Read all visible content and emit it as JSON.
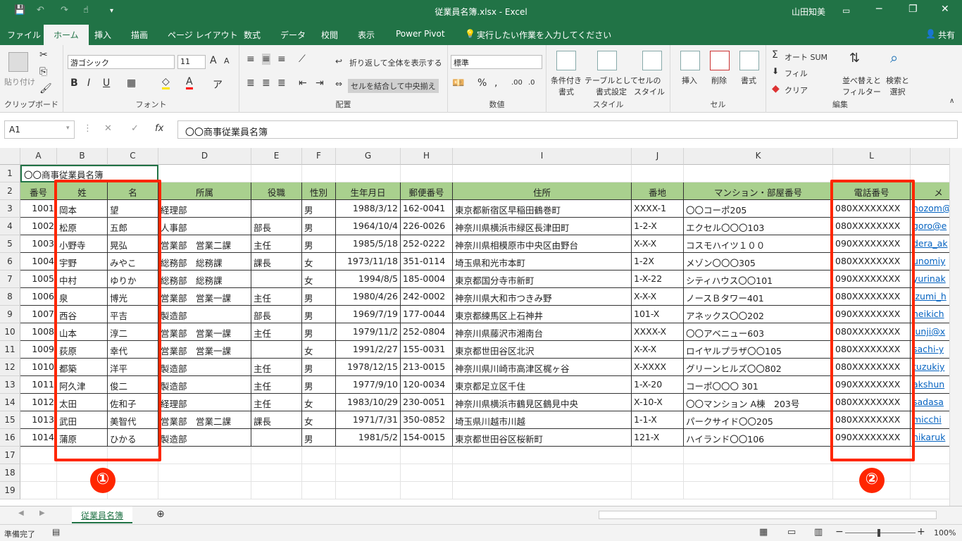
{
  "titlebar": {
    "doc": "従業員名簿.xlsx  -  Excel",
    "user": "山田知美",
    "save": "💾",
    "undo": "↶",
    "redo": "↷",
    "touch": "☝",
    "more": "▾",
    "ribbon_opt": "▭",
    "minimize": "─",
    "restore": "❐",
    "close": "✕"
  },
  "tabs": [
    "ファイル",
    "ホーム",
    "挿入",
    "描画",
    "ページ レイアウト",
    "数式",
    "データ",
    "校閲",
    "表示",
    "Power Pivot"
  ],
  "tellme": "実行したい作業を入力してください",
  "share": "共有",
  "ribbon": {
    "clipboard": {
      "label": "クリップボード",
      "paste": "貼り付け"
    },
    "font": {
      "label": "フォント",
      "name": "游ゴシック",
      "size": "11",
      "bold": "B",
      "italic": "I",
      "underline": "U"
    },
    "align": {
      "label": "配置",
      "wrap": "折り返して全体を表示する",
      "merge": "セルを結合して中央揃え"
    },
    "number": {
      "label": "数値",
      "format": "標準",
      "percent": "%",
      "comma": ","
    },
    "styles": {
      "label": "スタイル",
      "cond": "条件付き\n書式",
      "table": "テーブルとして\n書式設定",
      "cell": "セルの\nスタイル"
    },
    "cells": {
      "label": "セル",
      "insert": "挿入",
      "delete": "削除",
      "format": "書式"
    },
    "edit": {
      "label": "編集",
      "autosum": "オート SUM",
      "fill": "フィル",
      "clear": "クリア",
      "sort": "並べ替えと\nフィルター",
      "find": "検索と\n選択"
    }
  },
  "namebox": "A1",
  "formula": "〇〇商事従業員名簿",
  "fx": "fx",
  "columns": [
    "A",
    "B",
    "C",
    "D",
    "E",
    "F",
    "G",
    "H",
    "I",
    "J",
    "K",
    "L",
    ""
  ],
  "rows": [
    "1",
    "2",
    "3",
    "4",
    "5",
    "6",
    "7",
    "8",
    "9",
    "10",
    "11",
    "12",
    "13",
    "14",
    "15",
    "16",
    "17",
    "18",
    "19"
  ],
  "title": "〇〇商事従業員名簿",
  "headers": [
    "番号",
    "姓",
    "名",
    "所属",
    "役職",
    "性別",
    "生年月日",
    "郵便番号",
    "住所",
    "番地",
    "マンション・部屋番号",
    "電話番号",
    "メ"
  ],
  "data": [
    [
      "1001",
      "岡本",
      "望",
      "経理部",
      "",
      "男",
      "1988/3/12",
      "162-0041",
      "東京都新宿区早稲田鶴巻町",
      "XXXX-1",
      "〇〇コーポ205",
      "080XXXXXXXX",
      "nozom@"
    ],
    [
      "1002",
      "松原",
      "五郎",
      "人事部",
      "部長",
      "男",
      "1964/10/4",
      "226-0026",
      "神奈川県横浜市緑区長津田町",
      "1-2-X",
      "エクセル〇〇〇103",
      "080XXXXXXXX",
      "goro@e"
    ],
    [
      "1003",
      "小野寺",
      "晃弘",
      "営業部　営業二課",
      "主任",
      "男",
      "1985/5/18",
      "252-0222",
      "神奈川県相模原市中央区由野台",
      "X-X-X",
      "コスモハイツ１００",
      "090XXXXXXXX",
      "dera_ak"
    ],
    [
      "1004",
      "宇野",
      "みやこ",
      "総務部　総務課",
      "課長",
      "女",
      "1973/11/18",
      "351-0114",
      "埼玉県和光市本町",
      "1-2X",
      "メゾン〇〇〇305",
      "080XXXXXXXX",
      "unomiy"
    ],
    [
      "1005",
      "中村",
      "ゆりか",
      "総務部　総務課",
      "",
      "女",
      "1994/8/5",
      "185-0004",
      "東京都国分寺市新町",
      "1-X-22",
      "シティハウス〇〇101",
      "090XXXXXXXX",
      "yurinak"
    ],
    [
      "1006",
      "泉",
      "博光",
      "営業部　営業一課",
      "主任",
      "男",
      "1980/4/26",
      "242-0002",
      "神奈川県大和市つきみ野",
      "X-X-X",
      "ノースＢタワー401",
      "080XXXXXXXX",
      "izumi_h"
    ],
    [
      "1007",
      "西谷",
      "平吉",
      "製造部",
      "部長",
      "男",
      "1969/7/19",
      "177-0044",
      "東京都練馬区上石神井",
      "101-X",
      "アネックス〇〇202",
      "090XXXXXXXX",
      "heikich"
    ],
    [
      "1008",
      "山本",
      "淳二",
      "営業部　営業一課",
      "主任",
      "男",
      "1979/11/2",
      "252-0804",
      "神奈川県藤沢市湘南台",
      "XXXX-X",
      "〇〇アベニュー603",
      "080XXXXXXXX",
      "junji@x"
    ],
    [
      "1009",
      "荻原",
      "幸代",
      "営業部　営業一課",
      "",
      "女",
      "1991/2/27",
      "155-0031",
      "東京都世田谷区北沢",
      "X-X-X",
      "ロイヤルプラザ〇〇105",
      "080XXXXXXXX",
      "sachi-y"
    ],
    [
      "1010",
      "都築",
      "洋平",
      "製造部",
      "主任",
      "男",
      "1978/12/15",
      "213-0015",
      "神奈川県川崎市高津区梶ヶ谷",
      "X-XXXX",
      "グリーンヒルズ〇〇802",
      "080XXXXXXXX",
      "tuzukiy"
    ],
    [
      "1011",
      "阿久津",
      "俊二",
      "製造部",
      "主任",
      "男",
      "1977/9/10",
      "120-0034",
      "東京都足立区千住",
      "1-X-20",
      "コーポ〇〇〇 301",
      "090XXXXXXXX",
      "akshun"
    ],
    [
      "1012",
      "太田",
      "佐和子",
      "経理部",
      "主任",
      "女",
      "1983/10/29",
      "230-0051",
      "神奈川県横浜市鶴見区鶴見中央",
      "X-10-X",
      "〇〇マンション A棟　203号",
      "080XXXXXXXX",
      "sadasa"
    ],
    [
      "1013",
      "武田",
      "美智代",
      "営業部　営業二課",
      "課長",
      "女",
      "1971/7/31",
      "350-0852",
      "埼玉県川越市川越",
      "1-1-X",
      "パークサイド〇〇205",
      "080XXXXXXXX",
      "micchi"
    ],
    [
      "1014",
      "蒲原",
      "ひかる",
      "製造部",
      "",
      "男",
      "1981/5/2",
      "154-0015",
      "東京都世田谷区桜新町",
      "121-X",
      "ハイランド〇〇106",
      "090XXXXXXXX",
      "hikaruk"
    ]
  ],
  "badges": [
    "①",
    "②"
  ],
  "sheet": "従業員名簿",
  "status": {
    "ready": "準備完了",
    "zoom": "100%"
  },
  "colors": {
    "accent": "#217346",
    "header_fill": "#a9d08e",
    "highlight": "#ff2600",
    "link": "#0563c1"
  }
}
